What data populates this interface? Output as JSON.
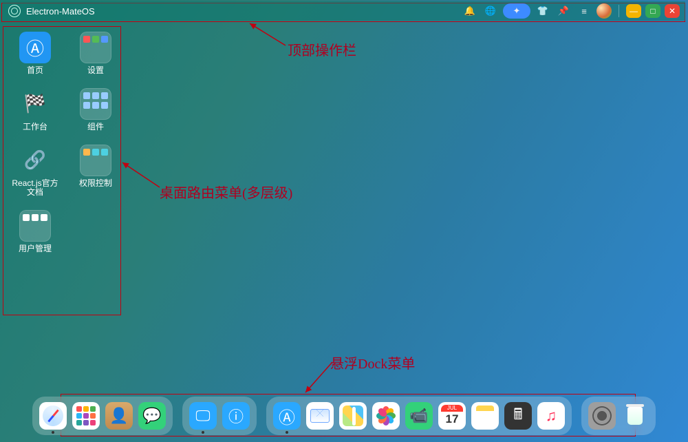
{
  "topbar": {
    "title": "Electron-MateOS",
    "icons": [
      "bell-icon",
      "globe-icon",
      "sparkle-icon",
      "shirt-icon",
      "pin-icon",
      "sliders-icon"
    ],
    "window_buttons": {
      "min": "—",
      "max": "□",
      "close": "✕"
    }
  },
  "desktop": {
    "apps": [
      {
        "id": "home",
        "label": "首页",
        "icon": "appstore-icon",
        "style": "blue"
      },
      {
        "id": "settings",
        "label": "设置",
        "icon": "folder-settings-icon",
        "style": "glass",
        "mini": [
          "#f55",
          "#5b5",
          "#59f"
        ]
      },
      {
        "id": "workbench",
        "label": "工作台",
        "icon": "gauge-icon",
        "style": "plain"
      },
      {
        "id": "components",
        "label": "组件",
        "icon": "folder-components-icon",
        "style": "glass",
        "mini": [
          "#9cf",
          "#9cf",
          "#9cf",
          "#9cf",
          "#9cf",
          "#9cf"
        ]
      },
      {
        "id": "reactdocs",
        "label": "React.js官方文档",
        "icon": "link-icon",
        "style": "plain"
      },
      {
        "id": "acl",
        "label": "权限控制",
        "icon": "folder-acl-icon",
        "style": "glass",
        "mini": [
          "#ffb74d",
          "#4dd0e1",
          "#4dd0e1"
        ]
      },
      {
        "id": "users",
        "label": "用户管理",
        "icon": "folder-users-icon",
        "style": "glass",
        "mini": [
          "#fff",
          "#fff",
          "#fff"
        ]
      }
    ]
  },
  "dock": {
    "group1": [
      {
        "id": "safari",
        "name": "safari-icon",
        "running": true
      },
      {
        "id": "launchpad",
        "name": "launchpad-icon"
      },
      {
        "id": "contacts",
        "name": "contacts-icon"
      },
      {
        "id": "messages",
        "name": "messages-icon"
      }
    ],
    "group2": [
      {
        "id": "thispc",
        "name": "display-icon",
        "running": true
      },
      {
        "id": "about",
        "name": "info-icon"
      }
    ],
    "group3": [
      {
        "id": "appstore",
        "name": "appstore-icon",
        "running": true
      },
      {
        "id": "mail",
        "name": "mail-icon"
      },
      {
        "id": "maps",
        "name": "maps-icon"
      },
      {
        "id": "photos",
        "name": "photos-icon"
      },
      {
        "id": "facetime",
        "name": "facetime-icon"
      },
      {
        "id": "calendar",
        "name": "calendar-icon",
        "month": "JUL",
        "day": "17"
      },
      {
        "id": "notes",
        "name": "notes-icon"
      },
      {
        "id": "calculator",
        "name": "calculator-icon"
      },
      {
        "id": "music",
        "name": "music-icon"
      }
    ],
    "group4": [
      {
        "id": "preferences",
        "name": "preferences-icon"
      },
      {
        "id": "trash",
        "name": "trash-icon"
      }
    ]
  },
  "annotations": {
    "topbar_label": "顶部操作栏",
    "desktop_label": "桌面路由菜单(多层级)",
    "dock_label": "悬浮Dock菜单"
  }
}
